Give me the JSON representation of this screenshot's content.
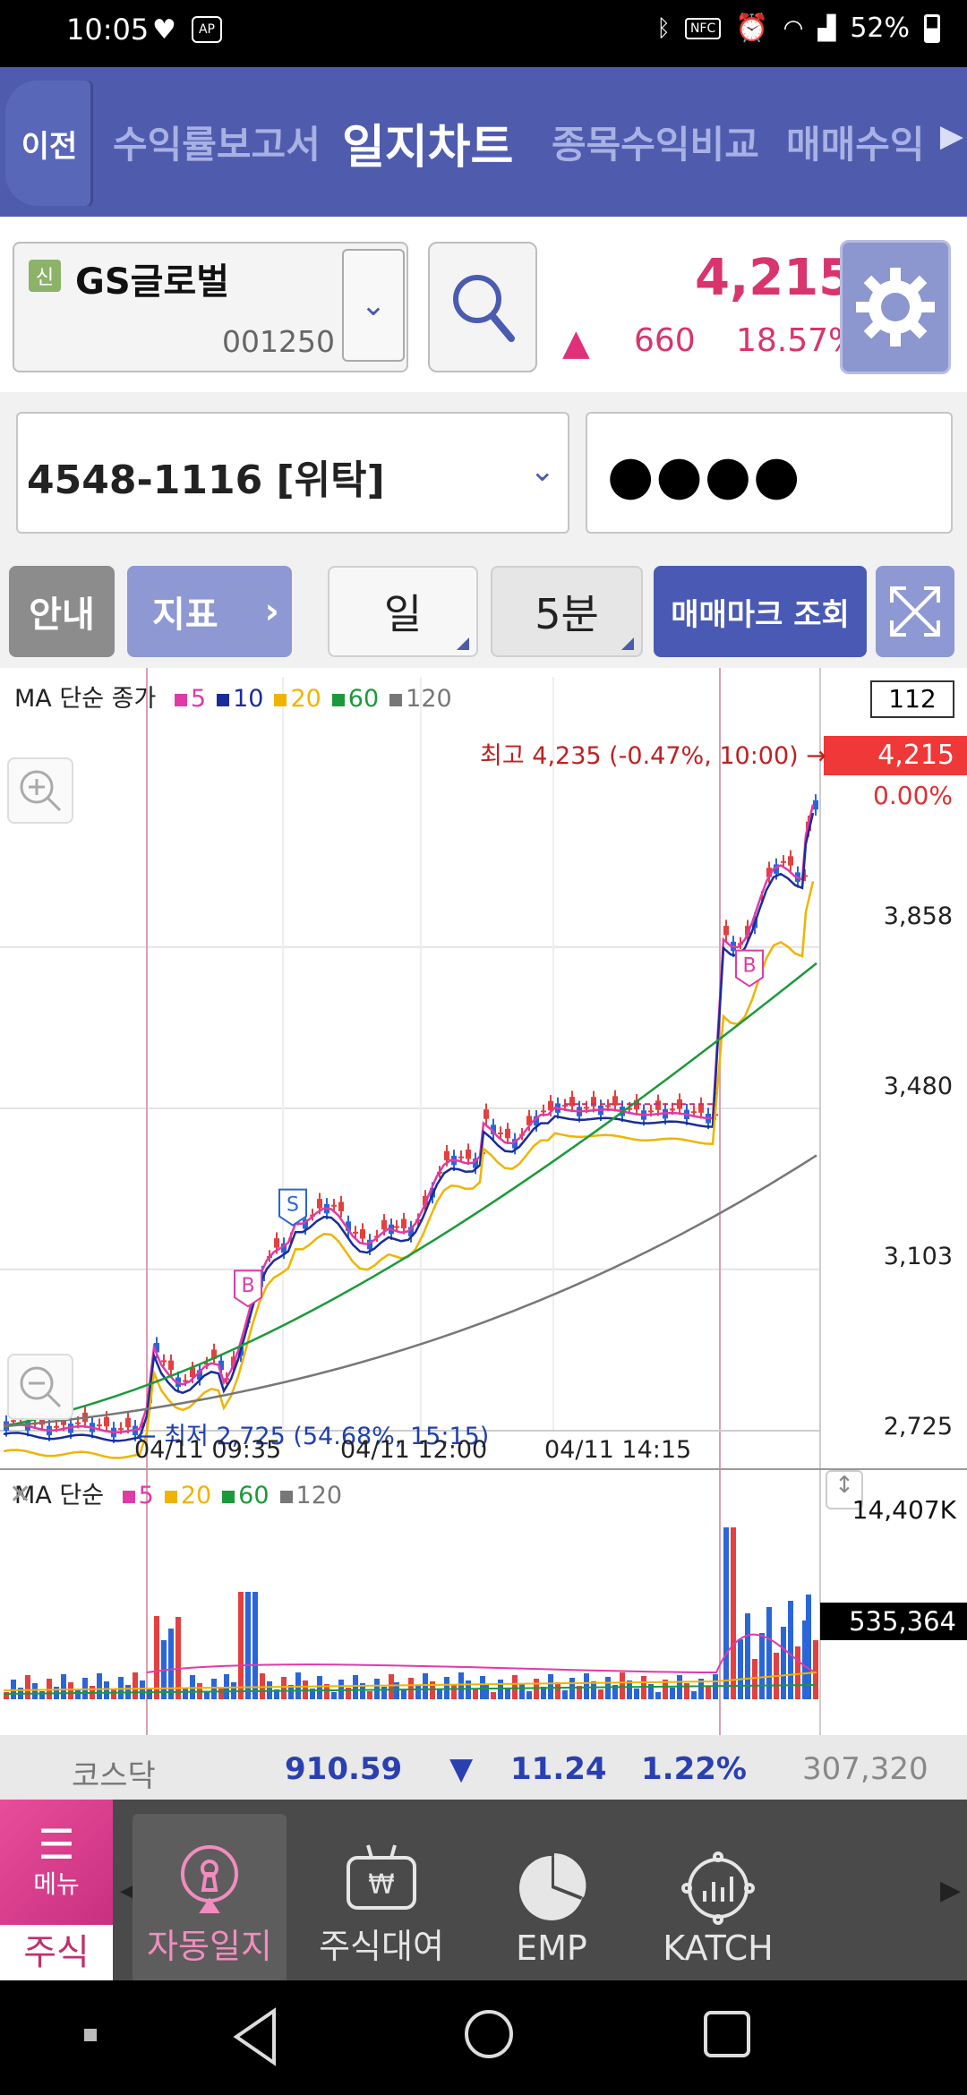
{
  "status": {
    "time": "10:05",
    "battery": "52%",
    "icons": [
      "heart-icon",
      "app-badge-icon",
      "bluetooth-icon",
      "nfc-icon",
      "alarm-icon",
      "wifi-icon",
      "signal-icon",
      "battery-icon"
    ]
  },
  "tabs": {
    "back": "이전",
    "items": [
      "수익률보고서",
      "일지차트",
      "종목수익비교",
      "매매수익"
    ],
    "active": 1
  },
  "stock": {
    "badge": "신",
    "name": "GS글로벌",
    "code": "001250",
    "price": "4,215",
    "change": "660",
    "change_pct": "18.57%"
  },
  "account": {
    "number": "4548-1116 [위탁]",
    "password": "●●●●"
  },
  "toolbar": {
    "guide": "안내",
    "indicator": "지표",
    "indicator_arrow": "›",
    "period": "일",
    "interval": "5분",
    "trade_mark": "매매마크 조회"
  },
  "chart": {
    "legend_top": {
      "prefix": "MA 단순 종가",
      "items": [
        {
          "label": "5",
          "color": "#e03aa8"
        },
        {
          "label": "10",
          "color": "#1a2c9a"
        },
        {
          "label": "20",
          "color": "#f0b400"
        },
        {
          "label": "60",
          "color": "#1a9a3a"
        },
        {
          "label": "120",
          "color": "#777777"
        }
      ]
    },
    "legend_vol": {
      "prefix": "MA 단순",
      "items": [
        {
          "label": "5",
          "color": "#e03aa8"
        },
        {
          "label": "20",
          "color": "#f0b400"
        },
        {
          "label": "60",
          "color": "#1a9a3a"
        },
        {
          "label": "120",
          "color": "#777777"
        }
      ]
    },
    "count_box": "112",
    "current_price": "4,215",
    "current_pct": "0.00%",
    "price_ticks": [
      "3,858",
      "3,480",
      "3,103",
      "2,725"
    ],
    "high_note": "최고 4,235 (-0.47%, 10:00) →",
    "low_note": "← 최저 2,725 (54.68%, 15:15)",
    "time_labels": [
      "04/11 09:35",
      "04/11 12:00",
      "04/11 14:15"
    ],
    "vol_max": "14,407K",
    "vol_current": "535,364",
    "buy_mark": "B",
    "sell_mark": "S"
  },
  "chart_data": {
    "type": "candlestick",
    "ylim": [
      2725,
      4235
    ],
    "price_ticks": [
      3858,
      3480,
      3103,
      2725
    ],
    "high": {
      "value": 4235,
      "pct": -0.47,
      "time": "10:00"
    },
    "low": {
      "value": 2725,
      "pct": 54.68,
      "time": "15:15"
    },
    "current": 4215,
    "volume": {
      "max_label": "14,407K",
      "current": 535364
    }
  },
  "kosdaq": {
    "label": "코스닥",
    "value": "910.59",
    "change": "11.24",
    "pct": "1.22%",
    "volume": "307,320"
  },
  "nav": {
    "menu": "메뉴",
    "stock": "주식",
    "items": [
      "자동일지",
      "주식대여",
      "EMP",
      "KATCH"
    ]
  }
}
